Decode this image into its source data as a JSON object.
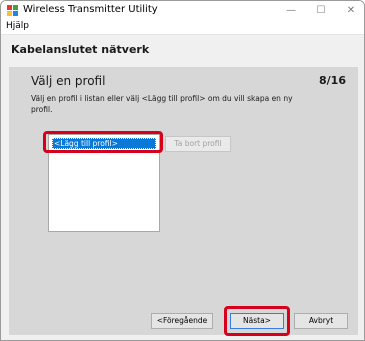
{
  "window": {
    "title": "Wireless Transmitter Utility",
    "minimize_glyph": "—",
    "maximize_glyph": "☐",
    "close_glyph": "✕"
  },
  "menu": {
    "help": "Hjälp"
  },
  "header": {
    "section_title": "Kabelanslutet nätverk"
  },
  "step": {
    "title": "Välj en profil",
    "counter": "8/16",
    "instruction": "Välj en profil i listan eller välj <Lägg till profil> om du vill skapa en ny profil."
  },
  "profiles": {
    "items": [
      "<Lägg till profil>"
    ],
    "remove_label": "Ta bort profil"
  },
  "footer": {
    "back_label": "<Föregående",
    "next_label": "Nästa>",
    "cancel_label": "Avbryt"
  },
  "colors": {
    "highlight": "#d6001c",
    "selection": "#0a78d7",
    "panel": "#d7d7d7"
  },
  "icons": {
    "app": "app-logo-icon"
  }
}
